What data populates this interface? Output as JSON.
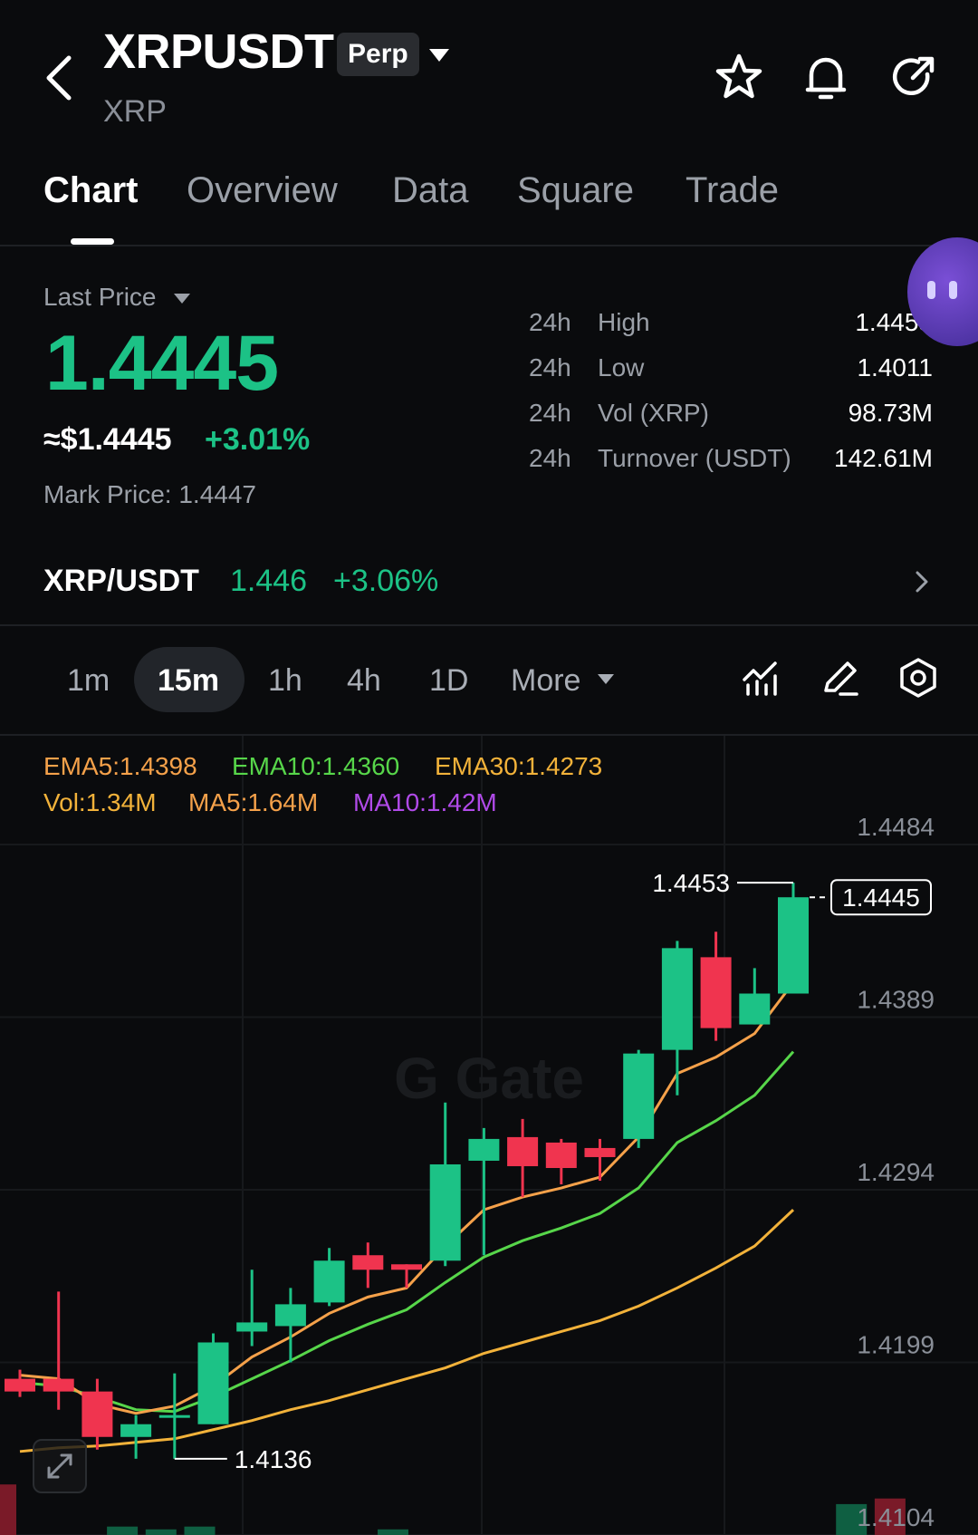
{
  "header": {
    "symbol": "XRPUSDT",
    "contract_type": "Perp",
    "base_name": "XRP"
  },
  "tabs": [
    {
      "label": "Chart",
      "active": true
    },
    {
      "label": "Overview",
      "active": false
    },
    {
      "label": "Data",
      "active": false
    },
    {
      "label": "Square",
      "active": false
    },
    {
      "label": "Trade",
      "active": false
    }
  ],
  "price": {
    "label": "Last Price",
    "last": "1.4445",
    "usd": "≈$1.4445",
    "change_pct": "+3.01%",
    "mark_price": "Mark Price: 1.4447"
  },
  "stats": [
    {
      "k1": "24h",
      "k2": "High",
      "v": "1.4453"
    },
    {
      "k1": "24h",
      "k2": "Low",
      "v": "1.4011"
    },
    {
      "k1": "24h",
      "k2": "Vol (XRP)",
      "v": "98.73M"
    },
    {
      "k1": "24h",
      "k2": "Turnover (USDT)",
      "v": "142.61M"
    }
  ],
  "spot": {
    "symbol": "XRP/USDT",
    "price": "1.446",
    "change": "+3.06%"
  },
  "intervals": [
    {
      "label": "1m",
      "active": false
    },
    {
      "label": "15m",
      "active": true
    },
    {
      "label": "1h",
      "active": false
    },
    {
      "label": "4h",
      "active": false
    },
    {
      "label": "1D",
      "active": false
    },
    {
      "label": "More",
      "active": false
    }
  ],
  "indicators": {
    "ema5": "EMA5:1.4398",
    "ema10": "EMA10:1.4360",
    "ema30": "EMA30:1.4273",
    "vol": "Vol:1.34M",
    "ma5": "MA5:1.64M",
    "ma10": "MA10:1.42M"
  },
  "colors": {
    "up": "#1cc286",
    "down": "#f0344f",
    "ema5": "#f5a14a",
    "ema10": "#57d64a",
    "ema30": "#f2b23a",
    "ma10": "#b04ae8"
  },
  "chart_data": {
    "type": "candlestick",
    "interval": "15m",
    "y_ticks": [
      "1.4484",
      "1.4389",
      "1.4294",
      "1.4199",
      "1.4104"
    ],
    "ylim": [
      1.4104,
      1.4484
    ],
    "last_price_label": "1.4445",
    "high_label": "1.4453",
    "low_label": "1.4136",
    "candles": [
      {
        "o": 1.418,
        "h": 1.4185,
        "l": 1.417,
        "c": 1.4173
      },
      {
        "o": 1.418,
        "h": 1.4228,
        "l": 1.4163,
        "c": 1.4173
      },
      {
        "o": 1.4173,
        "h": 1.418,
        "l": 1.4141,
        "c": 1.4148
      },
      {
        "o": 1.4148,
        "h": 1.416,
        "l": 1.4136,
        "c": 1.4155
      },
      {
        "o": 1.416,
        "h": 1.4183,
        "l": 1.4136,
        "c": 1.416
      },
      {
        "o": 1.4155,
        "h": 1.4205,
        "l": 1.4155,
        "c": 1.42
      },
      {
        "o": 1.4206,
        "h": 1.424,
        "l": 1.4198,
        "c": 1.4211
      },
      {
        "o": 1.4209,
        "h": 1.423,
        "l": 1.4189,
        "c": 1.4221
      },
      {
        "o": 1.4222,
        "h": 1.4252,
        "l": 1.422,
        "c": 1.4245
      },
      {
        "o": 1.4248,
        "h": 1.4255,
        "l": 1.423,
        "c": 1.424
      },
      {
        "o": 1.4243,
        "h": 1.4243,
        "l": 1.423,
        "c": 1.424
      },
      {
        "o": 1.4245,
        "h": 1.4332,
        "l": 1.4242,
        "c": 1.4298
      },
      {
        "o": 1.43,
        "h": 1.4318,
        "l": 1.4248,
        "c": 1.4312
      },
      {
        "o": 1.4313,
        "h": 1.4323,
        "l": 1.428,
        "c": 1.4297
      },
      {
        "o": 1.431,
        "h": 1.4312,
        "l": 1.4287,
        "c": 1.4296
      },
      {
        "o": 1.4307,
        "h": 1.4312,
        "l": 1.4289,
        "c": 1.4302
      },
      {
        "o": 1.4312,
        "h": 1.4361,
        "l": 1.4307,
        "c": 1.4359
      },
      {
        "o": 1.4361,
        "h": 1.4421,
        "l": 1.4336,
        "c": 1.4417
      },
      {
        "o": 1.4412,
        "h": 1.4426,
        "l": 1.4366,
        "c": 1.4373
      },
      {
        "o": 1.4375,
        "h": 1.4406,
        "l": 1.4375,
        "c": 1.4392
      },
      {
        "o": 1.4392,
        "h": 1.4453,
        "l": 1.4393,
        "c": 1.4445
      }
    ],
    "ema5": [
      1.4182,
      1.418,
      1.4166,
      1.4161,
      1.4165,
      1.4176,
      1.4192,
      1.4203,
      1.4216,
      1.4225,
      1.423,
      1.4253,
      1.4273,
      1.428,
      1.4285,
      1.4291,
      1.4313,
      1.4348,
      1.4357,
      1.437,
      1.4398
    ],
    "ema10": [
      1.4178,
      1.4176,
      1.417,
      1.4163,
      1.4162,
      1.417,
      1.418,
      1.419,
      1.4201,
      1.421,
      1.4218,
      1.4233,
      1.4247,
      1.4256,
      1.4263,
      1.4271,
      1.4285,
      1.431,
      1.4322,
      1.4336,
      1.436
    ],
    "ema30": [
      1.414,
      1.4142,
      1.4143,
      1.4145,
      1.4147,
      1.4152,
      1.4157,
      1.4163,
      1.4168,
      1.4174,
      1.418,
      1.4186,
      1.4194,
      1.42,
      1.4206,
      1.4212,
      1.422,
      1.423,
      1.4241,
      1.4253,
      1.4273
    ],
    "volume_bars": [
      {
        "i": 0,
        "up": false,
        "v": 0.9
      },
      {
        "i": 3,
        "up": true,
        "v": 0.15
      },
      {
        "i": 4,
        "up": true,
        "v": 0.1
      },
      {
        "i": 5,
        "up": true,
        "v": 0.15
      },
      {
        "i": 10,
        "up": true,
        "v": 0.1
      },
      {
        "i": 16,
        "up": true,
        "v": 0.55
      },
      {
        "i": 17,
        "up": false,
        "v": 0.65
      }
    ]
  }
}
